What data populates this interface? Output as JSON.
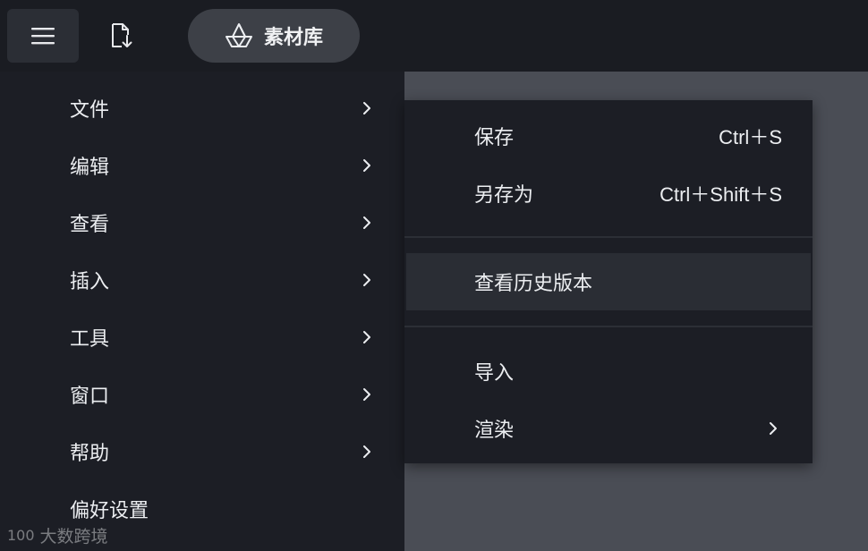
{
  "toolbar": {
    "menu_icon": "hamburger-icon",
    "import_icon": "file-import-icon",
    "library_icon": "library-icon",
    "library_label": "素材库"
  },
  "main_menu": {
    "items": [
      {
        "label": "文件",
        "has_submenu": true
      },
      {
        "label": "编辑",
        "has_submenu": true
      },
      {
        "label": "查看",
        "has_submenu": true
      },
      {
        "label": "插入",
        "has_submenu": true
      },
      {
        "label": "工具",
        "has_submenu": true
      },
      {
        "label": "窗口",
        "has_submenu": true
      },
      {
        "label": "帮助",
        "has_submenu": true
      },
      {
        "label": "偏好设置",
        "has_submenu": false
      }
    ]
  },
  "file_submenu": {
    "save_label": "保存",
    "save_shortcut": "Ctrl＋S",
    "save_as_label": "另存为",
    "save_as_shortcut": "Ctrl＋Shift＋S",
    "history_label": "查看历史版本",
    "import_label": "导入",
    "render_label": "渲染"
  },
  "watermark": {
    "logo_text": "100",
    "text": "大数跨境"
  },
  "colors": {
    "background": "#1a1c22",
    "menu": "#1c1e25",
    "canvas": "#4a4d55",
    "hover": "#2a2d34",
    "pill": "#3d4047"
  }
}
